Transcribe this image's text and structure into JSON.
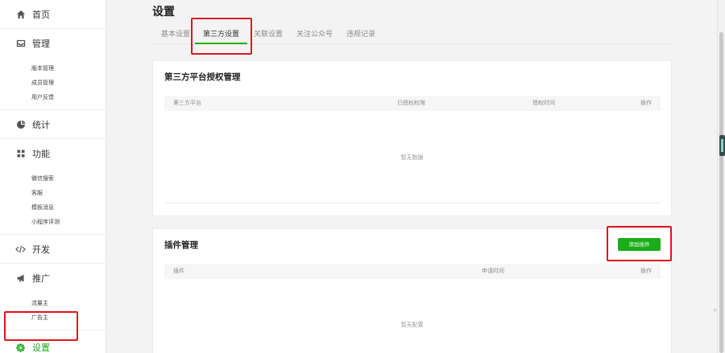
{
  "sidebar": {
    "home": {
      "label": "首页",
      "icon": "home-icon"
    },
    "manage": {
      "label": "管理",
      "icon": "inbox-icon",
      "items": [
        "版本管理",
        "成员管理",
        "用户反馈"
      ]
    },
    "stats": {
      "label": "统计",
      "icon": "pie-chart-icon"
    },
    "features": {
      "label": "功能",
      "icon": "grid-icon",
      "items": [
        "微信搜索",
        "客服",
        "模板消息",
        "小程序评测"
      ]
    },
    "dev": {
      "label": "开发",
      "icon": "code-icon"
    },
    "promo": {
      "label": "推广",
      "icon": "megaphone-icon",
      "items": [
        "流量主",
        "广告主"
      ]
    },
    "settings": {
      "label": "设置",
      "icon": "gear-icon"
    }
  },
  "header": {
    "title": "设置"
  },
  "tabs": [
    "基本设置",
    "第三方设置",
    "关联设置",
    "关注公众号",
    "违规记录"
  ],
  "active_tab": "第三方设置",
  "third_party": {
    "title": "第三方平台授权管理",
    "columns": [
      "第三方平台",
      "已授权权限",
      "授权时间",
      "操作"
    ],
    "empty_text": "暂无数据"
  },
  "plugins": {
    "title": "插件管理",
    "add_button": "添加插件",
    "columns": [
      "插件",
      "申请时间",
      "操作"
    ],
    "empty_text": "暂无配置"
  },
  "colors": {
    "accent": "#1aad19",
    "highlight": "#e0141e",
    "background": "#f3f3f3"
  }
}
